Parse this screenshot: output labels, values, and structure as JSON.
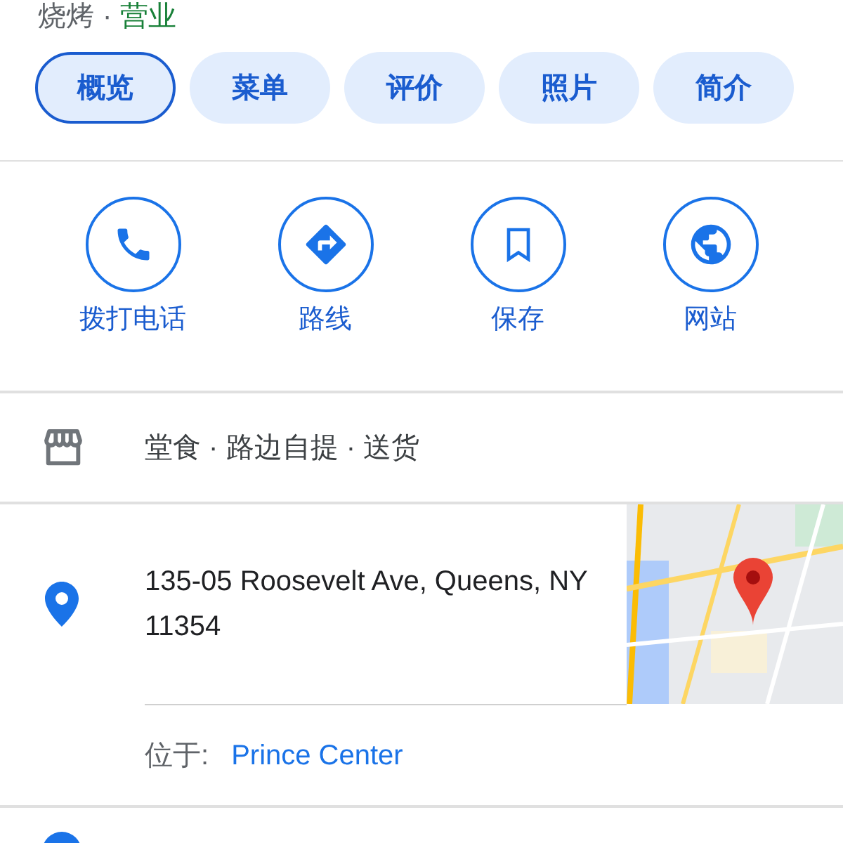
{
  "header": {
    "category": "烧烤",
    "separator": "·",
    "status": "营业"
  },
  "tabs": [
    {
      "label": "概览",
      "selected": true
    },
    {
      "label": "菜单",
      "selected": false
    },
    {
      "label": "评价",
      "selected": false
    },
    {
      "label": "照片",
      "selected": false
    },
    {
      "label": "简介",
      "selected": false
    }
  ],
  "actions": [
    {
      "kind": "phone",
      "label": "拨打电话"
    },
    {
      "kind": "directions",
      "label": "路线"
    },
    {
      "kind": "save",
      "label": "保存"
    },
    {
      "kind": "website",
      "label": "网站"
    }
  ],
  "service_options": "堂食 · 路边自提 · 送货",
  "address": {
    "text": "135-05 Roosevelt Ave, Queens, NY 11354",
    "located_in_label": "位于:",
    "located_in": "Prince Center"
  }
}
